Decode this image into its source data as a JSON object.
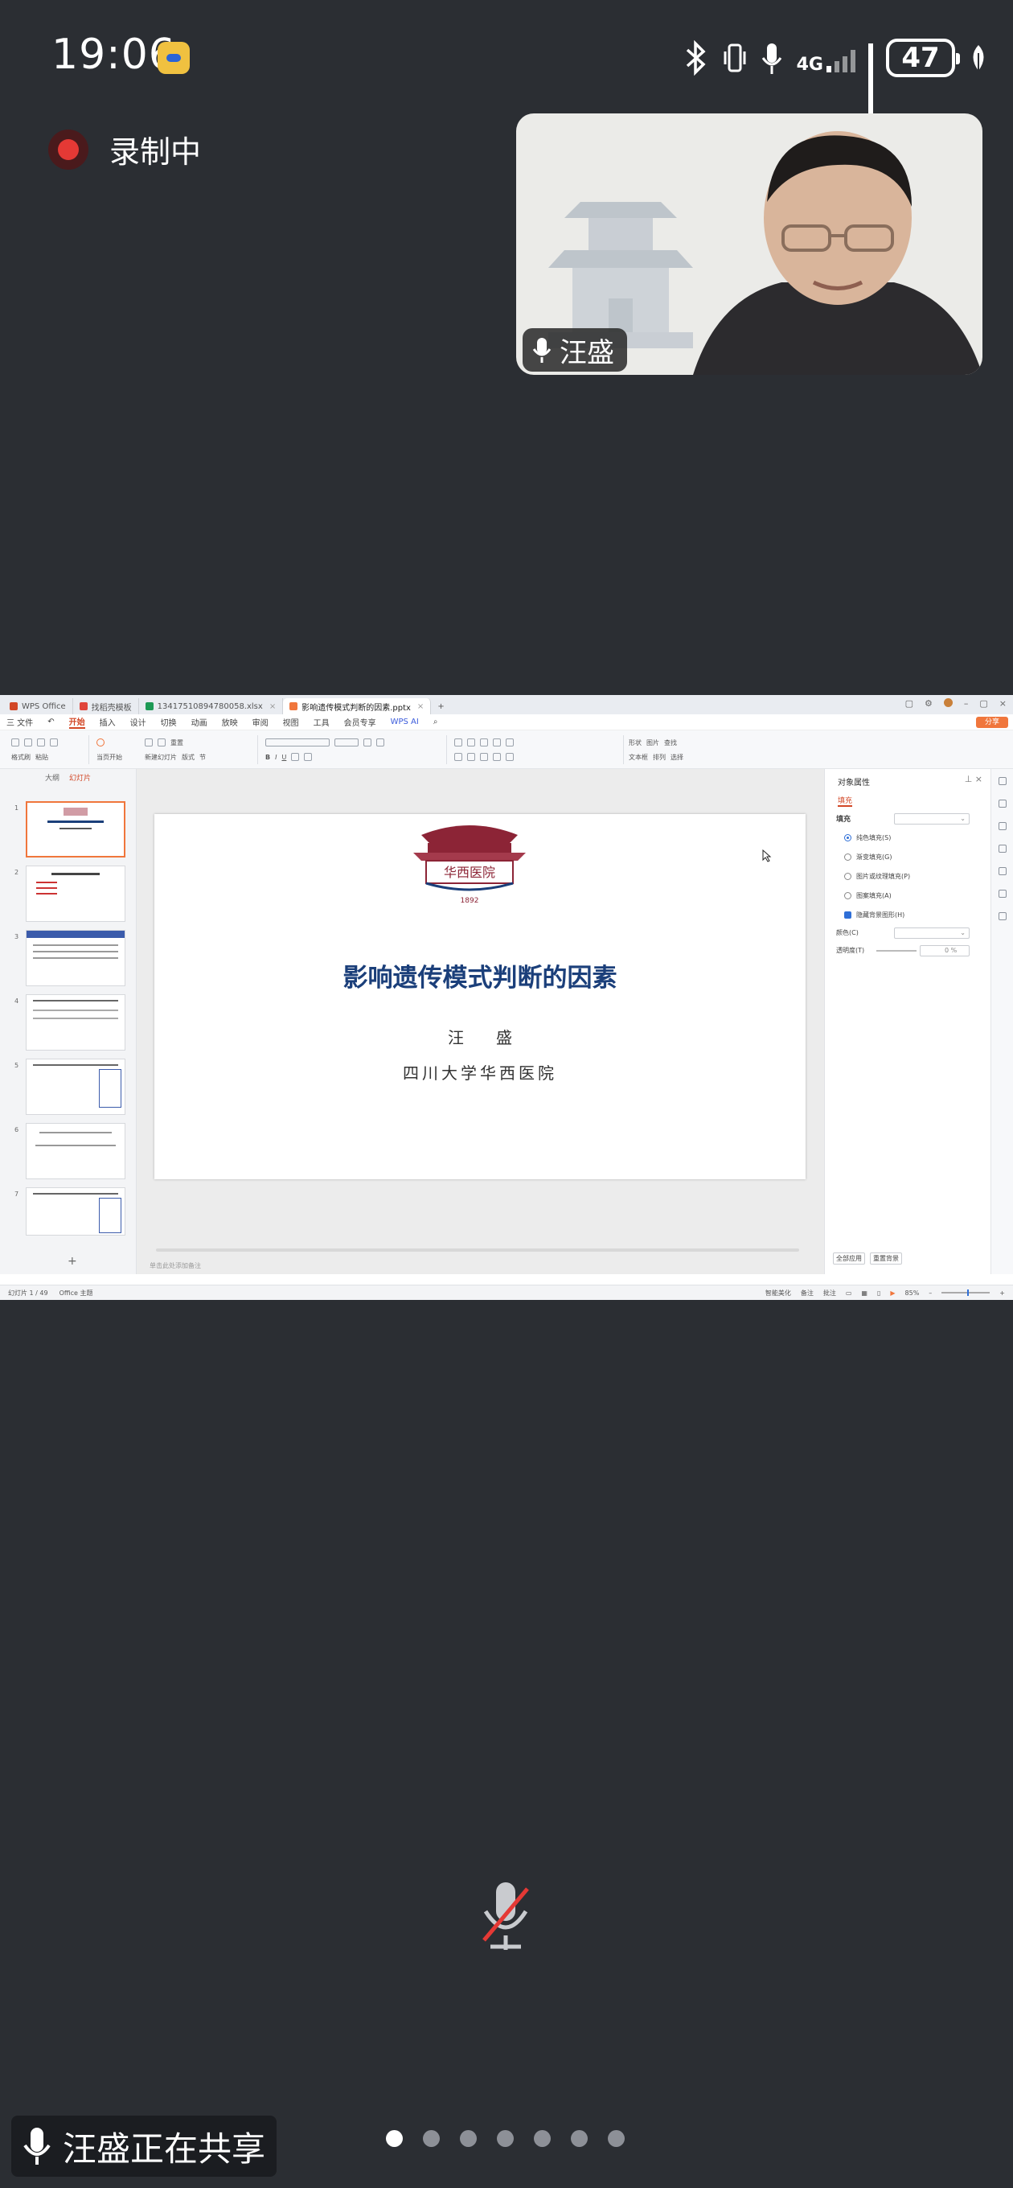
{
  "status_bar": {
    "time": "19:06",
    "network": "4G",
    "battery": "47"
  },
  "recording": {
    "label": "录制中"
  },
  "participant": {
    "name": "汪盛"
  },
  "shared_screen": {
    "tabs": [
      {
        "label": "WPS Office",
        "color": "#d24726"
      },
      {
        "label": "找稻壳模板",
        "color": "#e0443a"
      },
      {
        "label": "1341751089478005​8.xlsx",
        "color": "#1e9a55"
      },
      {
        "label": "影响遗传模式判断的因素.pptx",
        "color": "#f0763c"
      }
    ],
    "menu": {
      "file": "三 文件",
      "items": [
        "开始",
        "插入",
        "设计",
        "切换",
        "动画",
        "放映",
        "审阅",
        "视图",
        "工具",
        "会员专享"
      ],
      "active": "开始",
      "wps_ai": "WPS AI",
      "share": "分享"
    },
    "ribbon": {
      "format_painter": "格式刷",
      "paste": "粘贴",
      "play": "当页开始",
      "new_slide": "新建幻灯片",
      "layout": "版式",
      "section": "节",
      "reset": "重置",
      "shape": "形状",
      "picture": "图片",
      "textbox": "文本框",
      "arrange": "排列",
      "find": "查找",
      "select": "选择"
    },
    "slide_panel": {
      "tab_outline": "大纲",
      "tab_slides": "幻灯片",
      "numbers": [
        "1",
        "2",
        "3",
        "4",
        "5",
        "6",
        "7"
      ],
      "add": "+"
    },
    "slide": {
      "title": "影响遗传模式判断的因素",
      "author": "汪盛",
      "organization": "四川大学华西医院",
      "logo_text": "华西医院",
      "logo_year": "1892",
      "notes_placeholder": "单击此处添加备注"
    },
    "properties": {
      "header": "对象属性",
      "tab_fill": "填充",
      "section_fill": "填充",
      "options": [
        {
          "label": "纯色填充(S)",
          "selected": true
        },
        {
          "label": "渐变填充(G)",
          "selected": false
        },
        {
          "label": "图片或纹理填充(P)",
          "selected": false
        },
        {
          "label": "图案填充(A)",
          "selected": false
        }
      ],
      "hide_background": "隐藏背景图形(H)",
      "color_label": "颜色(C)",
      "transparency_label": "透明度(T)",
      "transparency_value": "0",
      "transparency_unit": "%",
      "apply_all": "全部应用",
      "reset_background": "重置背景"
    },
    "statusline": {
      "slide_count": "幻灯片 1 / 49",
      "theme": "Office 主题",
      "smart_beautify": "智能美化",
      "notes": "备注",
      "comments": "批注",
      "zoom": "85%"
    }
  },
  "bottom": {
    "sharing_label": "汪盛正在共享",
    "page_dots": 7,
    "active_dot": 1
  },
  "colors": {
    "background": "#2b2e33",
    "recording": "#e53935",
    "wps_accent": "#d24726",
    "slide_title": "#1b3f7a"
  }
}
